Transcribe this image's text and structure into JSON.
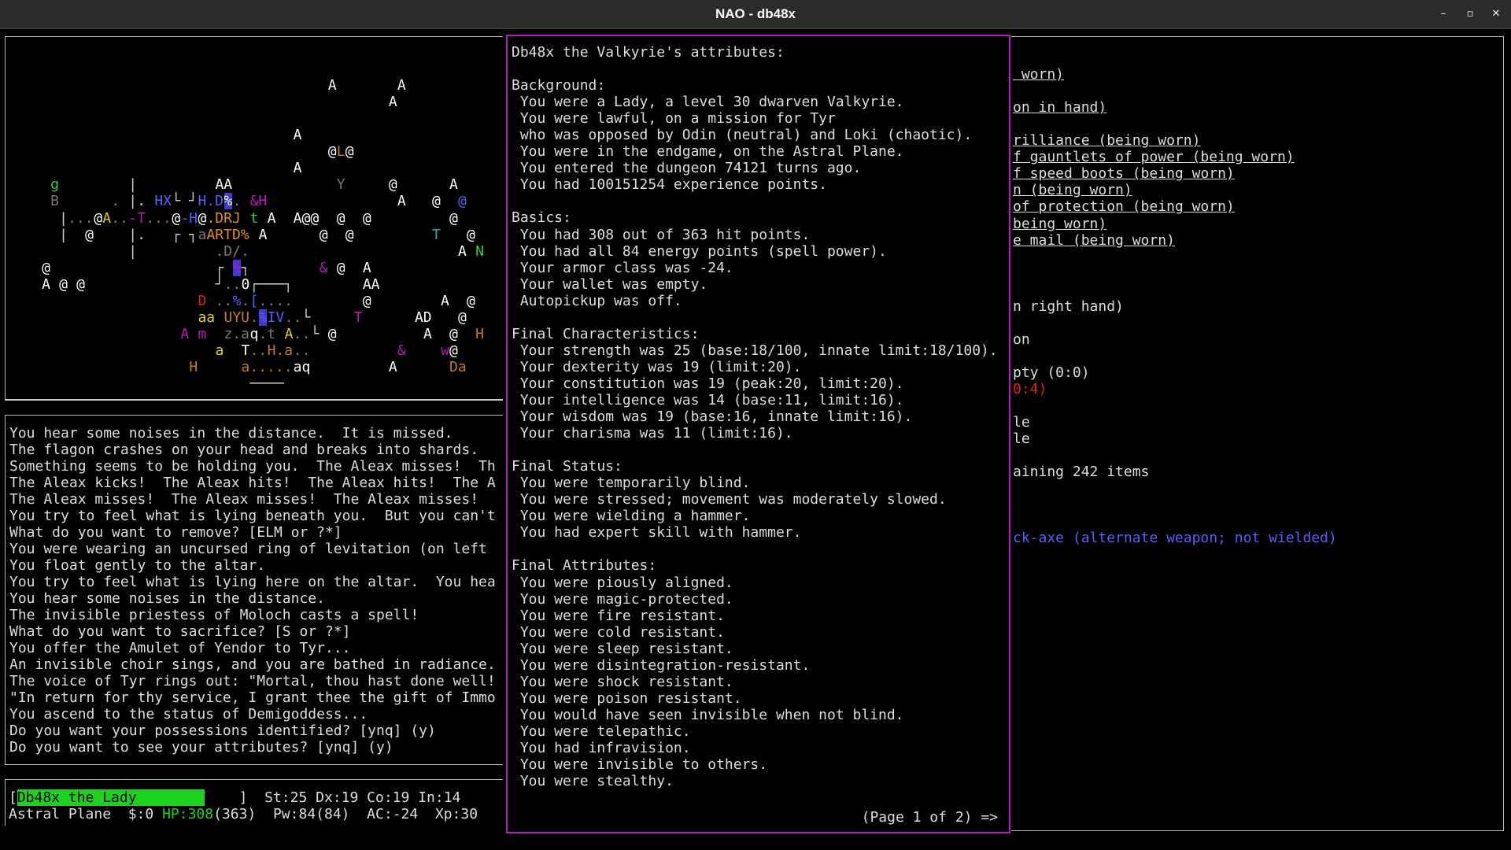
{
  "window": {
    "title": "NAO - db48x",
    "buttons": [
      {
        "name": "minimize-button",
        "glyph": "–"
      },
      {
        "name": "maximize-button",
        "glyph": "▫"
      },
      {
        "name": "close-button",
        "glyph": "✕"
      }
    ]
  },
  "map": {
    "glyphs": [
      {
        "row": 2,
        "col": 37,
        "text": "A",
        "color": "#ffffff"
      },
      {
        "row": 2,
        "col": 45,
        "text": "A",
        "color": "#ffffff"
      },
      {
        "row": 3,
        "col": 44,
        "text": "A",
        "color": "#ffffff"
      },
      {
        "row": 5,
        "col": 33,
        "text": "A",
        "color": "#ffffff"
      },
      {
        "row": 6,
        "col": 37,
        "text": "@",
        "color": "#ffffff"
      },
      {
        "row": 6,
        "col": 38,
        "text": "L",
        "color": "#c47a1f"
      },
      {
        "row": 6,
        "col": 39,
        "text": "@",
        "color": "#ffffff"
      },
      {
        "row": 7,
        "col": 33,
        "text": "A",
        "color": "#ffffff"
      },
      {
        "row": 8,
        "col": 5,
        "text": "g",
        "color": "#2ecc40"
      },
      {
        "row": 8,
        "col": 14,
        "text": "|",
        "color": "#cccccc"
      },
      {
        "row": 8,
        "col": 24,
        "text": "AA",
        "color": "#ffffff"
      },
      {
        "row": 8,
        "col": 38,
        "text": "Y",
        "color": "#777777"
      },
      {
        "row": 8,
        "col": 44,
        "text": "@",
        "color": "#ffffff"
      },
      {
        "row": 8,
        "col": 51,
        "text": "A",
        "color": "#ffffff"
      },
      {
        "row": 9,
        "col": 5,
        "text": "B",
        "color": "#777777"
      },
      {
        "row": 9,
        "col": 12,
        "text": ".",
        "color": "#777777"
      },
      {
        "row": 9,
        "col": 14,
        "text": "|.",
        "color": "#cccccc"
      },
      {
        "row": 9,
        "col": 17,
        "text": "HX",
        "color": "#5b5bff"
      },
      {
        "row": 9,
        "col": 19,
        "text": "└ ┘",
        "color": "#cccccc"
      },
      {
        "row": 9,
        "col": 22,
        "text": "H.D",
        "color": "#5b5bff"
      },
      {
        "row": 9,
        "col": 25,
        "text": "%",
        "color": "#ffffff",
        "bg": "#3b3bcf"
      },
      {
        "row": 9,
        "col": 26,
        "text": ".",
        "color": "#777777"
      },
      {
        "row": 9,
        "col": 28,
        "text": "&H",
        "color": "#b818b8"
      },
      {
        "row": 9,
        "col": 45,
        "text": "A",
        "color": "#ffffff"
      },
      {
        "row": 9,
        "col": 49,
        "text": "@",
        "color": "#ffffff"
      },
      {
        "row": 9,
        "col": 52,
        "text": "@",
        "color": "#5b5bff"
      },
      {
        "row": 10,
        "col": 6,
        "text": "|",
        "color": "#cccccc"
      },
      {
        "row": 10,
        "col": 7,
        "text": "...",
        "color": "#777777"
      },
      {
        "row": 10,
        "col": 10,
        "text": "@",
        "color": "#ffffff"
      },
      {
        "row": 10,
        "col": 11,
        "text": "A",
        "color": "#e0d020"
      },
      {
        "row": 10,
        "col": 12,
        "text": "..",
        "color": "#777777"
      },
      {
        "row": 10,
        "col": 14,
        "text": "-T",
        "color": "#b818b8"
      },
      {
        "row": 10,
        "col": 16,
        "text": "...",
        "color": "#777777"
      },
      {
        "row": 10,
        "col": 19,
        "text": "@",
        "color": "#ffffff"
      },
      {
        "row": 10,
        "col": 20,
        "text": "-H",
        "color": "#5b5bff"
      },
      {
        "row": 10,
        "col": 22,
        "text": "@",
        "color": "#ffffff"
      },
      {
        "row": 10,
        "col": 23,
        "text": ".DRJ",
        "color": "#e08a1f"
      },
      {
        "row": 10,
        "col": 28,
        "text": "t",
        "color": "#2ecc40"
      },
      {
        "row": 10,
        "col": 30,
        "text": "A",
        "color": "#ffffff"
      },
      {
        "row": 10,
        "col": 33,
        "text": "A@@",
        "color": "#ffffff"
      },
      {
        "row": 10,
        "col": 38,
        "text": "@",
        "color": "#ffffff"
      },
      {
        "row": 10,
        "col": 41,
        "text": "@",
        "color": "#ffffff"
      },
      {
        "row": 10,
        "col": 51,
        "text": "@",
        "color": "#ffffff"
      },
      {
        "row": 11,
        "col": 6,
        "text": "|",
        "color": "#cccccc"
      },
      {
        "row": 11,
        "col": 9,
        "text": "@",
        "color": "#ffffff"
      },
      {
        "row": 11,
        "col": 14,
        "text": "|.",
        "color": "#cccccc"
      },
      {
        "row": 11,
        "col": 19,
        "text": "┌ ┐",
        "color": "#cccccc"
      },
      {
        "row": 11,
        "col": 22,
        "text": "a",
        "color": "#777777"
      },
      {
        "row": 11,
        "col": 23,
        "text": "ARTD%",
        "color": "#e08a1f"
      },
      {
        "row": 11,
        "col": 29,
        "text": "A",
        "color": "#ffffff"
      },
      {
        "row": 11,
        "col": 36,
        "text": "@",
        "color": "#ffffff"
      },
      {
        "row": 11,
        "col": 39,
        "text": "@",
        "color": "#ffffff"
      },
      {
        "row": 11,
        "col": 49,
        "text": "T",
        "color": "#1fb2b2"
      },
      {
        "row": 11,
        "col": 53,
        "text": "@",
        "color": "#ffffff"
      },
      {
        "row": 12,
        "col": 14,
        "text": "|",
        "color": "#cccccc"
      },
      {
        "row": 12,
        "col": 24,
        "text": ".D/.",
        "color": "#777777"
      },
      {
        "row": 12,
        "col": 52,
        "text": "A",
        "color": "#ffffff"
      },
      {
        "row": 12,
        "col": 54,
        "text": "N",
        "color": "#2ecc40"
      },
      {
        "row": 13,
        "col": 4,
        "text": "@",
        "color": "#ffffff"
      },
      {
        "row": 13,
        "col": 24,
        "text": "┌",
        "color": "#cccccc"
      },
      {
        "row": 13,
        "col": 26,
        "text": "%",
        "color": "#b818b8",
        "bg": "#3b3bcf"
      },
      {
        "row": 13,
        "col": 27,
        "text": "┐",
        "color": "#cccccc"
      },
      {
        "row": 13,
        "col": 36,
        "text": "&",
        "color": "#b818b8"
      },
      {
        "row": 13,
        "col": 38,
        "text": "@",
        "color": "#ffffff"
      },
      {
        "row": 13,
        "col": 41,
        "text": "A",
        "color": "#ffffff"
      },
      {
        "row": 14,
        "col": 4,
        "text": "A",
        "color": "#ffffff"
      },
      {
        "row": 14,
        "col": 6,
        "text": "@",
        "color": "#ffffff"
      },
      {
        "row": 14,
        "col": 8,
        "text": "@",
        "color": "#ffffff"
      },
      {
        "row": 14,
        "col": 24,
        "text": "┘",
        "color": "#cccccc"
      },
      {
        "row": 14,
        "col": 25,
        "text": "..",
        "color": "#777777"
      },
      {
        "row": 14,
        "col": 27,
        "text": "0",
        "color": "#ffffff"
      },
      {
        "row": 14,
        "col": 28,
        "text": "┌───┐",
        "color": "#cccccc"
      },
      {
        "row": 14,
        "col": 41,
        "text": "AA",
        "color": "#ffffff"
      },
      {
        "row": 15,
        "col": 22,
        "text": "D",
        "color": "#e02020"
      },
      {
        "row": 15,
        "col": 24,
        "text": "..",
        "color": "#777777"
      },
      {
        "row": 15,
        "col": 26,
        "text": "%",
        "color": "#5b5bff"
      },
      {
        "row": 15,
        "col": 27,
        "text": ".",
        "color": "#777777"
      },
      {
        "row": 15,
        "col": 28,
        "text": "[",
        "color": "#5b5bff"
      },
      {
        "row": 15,
        "col": 29,
        "text": "....",
        "color": "#777777"
      },
      {
        "row": 15,
        "col": 41,
        "text": "@",
        "color": "#ffffff"
      },
      {
        "row": 15,
        "col": 50,
        "text": "A",
        "color": "#ffffff"
      },
      {
        "row": 15,
        "col": 53,
        "text": "@",
        "color": "#ffffff"
      },
      {
        "row": 16,
        "col": 22,
        "text": "aa",
        "color": "#e0d020"
      },
      {
        "row": 16,
        "col": 25,
        "text": "UYU",
        "color": "#c47a1f"
      },
      {
        "row": 16,
        "col": 28,
        "text": ".",
        "color": "#777777"
      },
      {
        "row": 16,
        "col": 29,
        "text": "%",
        "color": "#5b5bff",
        "bg": "#3b3bcf"
      },
      {
        "row": 16,
        "col": 30,
        "text": "IV",
        "color": "#5b5bff"
      },
      {
        "row": 16,
        "col": 32,
        "text": "..",
        "color": "#777777"
      },
      {
        "row": 16,
        "col": 34,
        "text": "└",
        "color": "#cccccc"
      },
      {
        "row": 16,
        "col": 40,
        "text": "T",
        "color": "#b818b8"
      },
      {
        "row": 16,
        "col": 47,
        "text": "AD",
        "color": "#ffffff"
      },
      {
        "row": 16,
        "col": 52,
        "text": "@",
        "color": "#ffffff"
      },
      {
        "row": 17,
        "col": 20,
        "text": "A",
        "color": "#b818b8"
      },
      {
        "row": 17,
        "col": 22,
        "text": "m",
        "color": "#b818b8"
      },
      {
        "row": 17,
        "col": 25,
        "text": "z.a",
        "color": "#777777"
      },
      {
        "row": 17,
        "col": 28,
        "text": "q",
        "color": "#ffffff"
      },
      {
        "row": 17,
        "col": 29,
        "text": ".t",
        "color": "#777777"
      },
      {
        "row": 17,
        "col": 32,
        "text": "A",
        "color": "#e0d020"
      },
      {
        "row": 17,
        "col": 33,
        "text": "..",
        "color": "#777777"
      },
      {
        "row": 17,
        "col": 35,
        "text": "└",
        "color": "#cccccc"
      },
      {
        "row": 17,
        "col": 37,
        "text": "@",
        "color": "#ffffff"
      },
      {
        "row": 17,
        "col": 48,
        "text": "A",
        "color": "#ffffff"
      },
      {
        "row": 17,
        "col": 51,
        "text": "@",
        "color": "#ffffff"
      },
      {
        "row": 17,
        "col": 54,
        "text": "H",
        "color": "#c47a1f"
      },
      {
        "row": 18,
        "col": 24,
        "text": "a",
        "color": "#e0d020"
      },
      {
        "row": 18,
        "col": 27,
        "text": "T",
        "color": "#ffffff"
      },
      {
        "row": 18,
        "col": 28,
        "text": "..",
        "color": "#777777"
      },
      {
        "row": 18,
        "col": 30,
        "text": "H.a",
        "color": "#c47a1f"
      },
      {
        "row": 18,
        "col": 33,
        "text": "..",
        "color": "#777777"
      },
      {
        "row": 18,
        "col": 45,
        "text": "&",
        "color": "#b818b8"
      },
      {
        "row": 18,
        "col": 50,
        "text": "w",
        "color": "#b818b8"
      },
      {
        "row": 18,
        "col": 51,
        "text": "@",
        "color": "#ffffff"
      },
      {
        "row": 19,
        "col": 21,
        "text": "H",
        "color": "#c47a1f"
      },
      {
        "row": 19,
        "col": 27,
        "text": "a.....",
        "color": "#c47a1f"
      },
      {
        "row": 19,
        "col": 33,
        "text": "aq",
        "color": "#ffffff"
      },
      {
        "row": 19,
        "col": 44,
        "text": "A",
        "color": "#ffffff"
      },
      {
        "row": 19,
        "col": 51,
        "text": "Da",
        "color": "#c47a1f"
      },
      {
        "row": 20,
        "col": 28,
        "text": "────",
        "color": "#cccccc"
      }
    ]
  },
  "messages": [
    "You hear some noises in the distance.  It is missed.",
    "The flagon crashes on your head and breaks into shards.",
    "Something seems to be holding you.  The Aleax misses!  Th",
    "The Aleax kicks!  The Aleax hits!  The Aleax hits!  The A",
    "The Aleax misses!  The Aleax misses!  The Aleax misses!",
    "You try to feel what is lying beneath you.  But you can't",
    "What do you want to remove? [ELM or ?*]",
    "You were wearing an uncursed ring of levitation (on left",
    "You float gently to the altar.",
    "You try to feel what is lying here on the altar.  You hea",
    "You hear some noises in the distance.",
    "The invisible priestess of Moloch casts a spell!",
    "What do you want to sacrifice? [S or ?*]",
    "You offer the Amulet of Yendor to Tyr...",
    "An invisible choir sings, and you are bathed in radiance.",
    "The voice of Tyr rings out: \"Mortal, thou hast done well!",
    "\"In return for thy service, I grant thee the gift of Immo",
    "You ascend to the status of Demigoddess...",
    "Do you want your possessions identified? [ynq] (y)",
    "Do you want to see your attributes? [ynq] (y)"
  ],
  "status": {
    "open_bracket": "[",
    "name": "Db48x the Lady        ",
    "close_bracket": "    ]",
    "stats": "  St:25 Dx:19 Co:19 In:14",
    "location": "Astral Plane  $:0 ",
    "hp": "HP:308",
    "hp_max": "(363)",
    "rest": "  Pw:84(84)  AC:-24  Xp:30"
  },
  "attributes": {
    "lines": [
      "Db48x the Valkyrie's attributes:",
      "",
      "Background:",
      " You were a Lady, a level 30 dwarven Valkyrie.",
      " You were lawful, on a mission for Tyr",
      " who was opposed by Odin (neutral) and Loki (chaotic).",
      " You were in the endgame, on the Astral Plane.",
      " You entered the dungeon 74121 turns ago.",
      " You had 100151254 experience points.",
      "",
      "Basics:",
      " You had 308 out of 363 hit points.",
      " You had all 84 energy points (spell power).",
      " Your armor class was -24.",
      " Your wallet was empty.",
      " Autopickup was off.",
      "",
      "Final Characteristics:",
      " Your strength was 25 (base:18/100, innate limit:18/100).",
      " Your dexterity was 19 (limit:20).",
      " Your constitution was 19 (peak:20, limit:20).",
      " Your intelligence was 14 (base:11, limit:16).",
      " Your wisdom was 19 (base:16, innate limit:16).",
      " Your charisma was 11 (limit:16).",
      "",
      "Final Status:",
      " You were temporarily blind.",
      " You were stressed; movement was moderately slowed.",
      " You were wielding a hammer.",
      " You had expert skill with hammer.",
      "",
      "Final Attributes:",
      " You were piously aligned.",
      " You were magic-protected.",
      " You were fire resistant.",
      " You were cold resistant.",
      " You were sleep resistant.",
      " You were disintegration-resistant.",
      " You were shock resistant.",
      " You were poison resistant.",
      " You would have seen invisible when not blind.",
      " You were telepathic.",
      " You had infravision.",
      " You were invisible to others.",
      " You were stealthy."
    ],
    "pager": "(Page 1 of 2) =>"
  },
  "inventory": {
    "lines": [
      {
        "row": 1,
        "text": " worn)",
        "style": "u",
        "color": "#dddddd"
      },
      {
        "row": 3,
        "text": "on in hand)",
        "style": "u",
        "color": "#dddddd"
      },
      {
        "row": 5,
        "text": "rilliance (being worn)",
        "style": "u",
        "color": "#dddddd"
      },
      {
        "row": 6,
        "text": "f gauntlets of power (being worn)",
        "style": "u",
        "color": "#dddddd"
      },
      {
        "row": 7,
        "text": "f speed boots (being worn)",
        "style": "u",
        "color": "#dddddd"
      },
      {
        "row": 8,
        "text": "n (being worn)",
        "style": "u",
        "color": "#dddddd"
      },
      {
        "row": 9,
        "text": "of protection (being worn)",
        "style": "u",
        "color": "#dddddd"
      },
      {
        "row": 10,
        "text": "being worn)",
        "style": "u",
        "color": "#dddddd"
      },
      {
        "row": 11,
        "text": "e mail (being worn)",
        "style": "u",
        "color": "#dddddd"
      },
      {
        "row": 15,
        "text": "n right hand)",
        "style": "",
        "color": "#dddddd"
      },
      {
        "row": 17,
        "text": "on",
        "style": "",
        "color": "#dddddd"
      },
      {
        "row": 19,
        "text": "pty (0:0)",
        "style": "",
        "color": "#dddddd"
      },
      {
        "row": 20,
        "text": "0:4)",
        "style": "",
        "color": "#e02020"
      },
      {
        "row": 22,
        "text": "le",
        "style": "",
        "color": "#dddddd"
      },
      {
        "row": 23,
        "text": "le",
        "style": "",
        "color": "#dddddd"
      },
      {
        "row": 25,
        "text": "aining 242 items",
        "style": "",
        "color": "#dddddd"
      },
      {
        "row": 29,
        "text": "ck-axe (alternate weapon; not wielded)",
        "style": "",
        "color": "#5b5bff"
      }
    ]
  }
}
